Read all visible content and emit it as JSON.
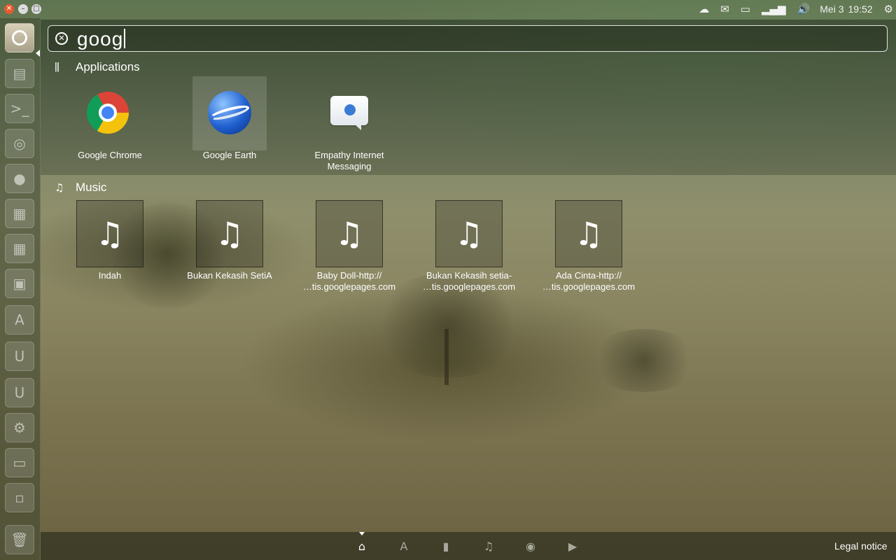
{
  "panel": {
    "clock_day": "Mei 3",
    "clock_time": "19:52",
    "tray_icons": [
      "cloud-icon",
      "mail-icon",
      "battery-icon",
      "network-signal-icon",
      "volume-icon",
      "session-gear-icon"
    ]
  },
  "launcher": {
    "items": [
      "ubuntu-bfb-icon",
      "files-icon",
      "terminal-icon",
      "disk-icon",
      "firefox-icon",
      "libreoffice-writer-icon",
      "libreoffice-calc-icon",
      "libreoffice-impress-icon",
      "software-center-icon",
      "ubuntu-one-icon",
      "ubuntu-one-music-icon",
      "system-settings-icon",
      "workspace-icon",
      "workspace-switcher-icon",
      "trash-icon"
    ]
  },
  "search": {
    "query": "goog"
  },
  "applications": {
    "title": "Applications",
    "items": [
      {
        "label": "Google Chrome",
        "icon": "google-chrome-icon"
      },
      {
        "label": "Google Earth",
        "icon": "google-earth-icon"
      },
      {
        "label": "Empathy Internet Messaging",
        "icon": "empathy-icon"
      }
    ]
  },
  "music": {
    "title": "Music",
    "items": [
      {
        "line1": "Indah",
        "line2": ""
      },
      {
        "line1": "Bukan Kekasih SetiA",
        "line2": ""
      },
      {
        "line1": "Baby Doll-http://",
        "line2": "…tis.googlepages.com"
      },
      {
        "line1": "Bukan Kekasih setia-",
        "line2": "…tis.googlepages.com"
      },
      {
        "line1": "Ada Cinta-http://",
        "line2": "…tis.googlepages.com"
      }
    ]
  },
  "lens_bar": {
    "lenses": [
      "home-lens-icon",
      "applications-lens-icon",
      "files-lens-icon",
      "music-lens-icon",
      "photos-lens-icon",
      "video-lens-icon"
    ],
    "legal": "Legal notice"
  }
}
